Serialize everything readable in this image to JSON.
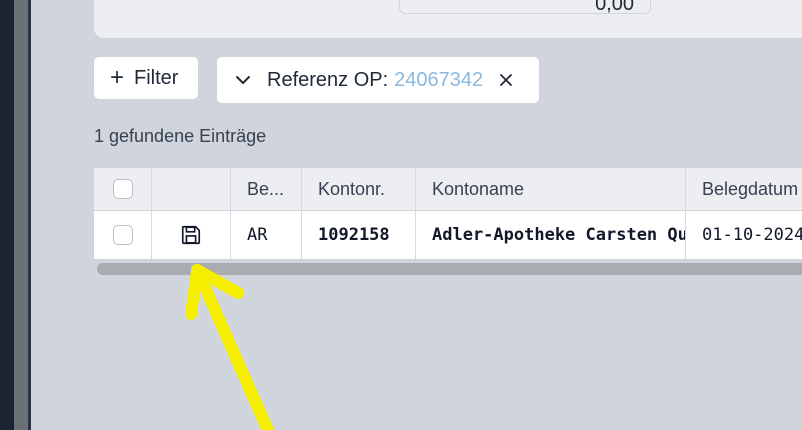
{
  "top_panel": {
    "value": "0,00"
  },
  "filters": {
    "add_label": "Filter",
    "chip_label": "Referenz OP:",
    "chip_value": "24067342"
  },
  "results": {
    "count_text": "1 gefundene Einträge"
  },
  "table": {
    "headers": [
      "",
      "",
      "Be...",
      "Kontonr.",
      "Kontoname",
      "Belegdatum"
    ],
    "rows": [
      [
        "",
        "",
        "AR",
        "1092158",
        "Adler-Apotheke Carsten Qu",
        "01-10-2024"
      ]
    ]
  },
  "icons": {
    "add": "plus-icon",
    "chip_toggle": "chevron-down-icon",
    "chip_remove": "close-icon",
    "row_action": "save-icon"
  },
  "colors": {
    "chip_value": "#8ab8df",
    "annotation_arrow": "#f6ee00"
  }
}
